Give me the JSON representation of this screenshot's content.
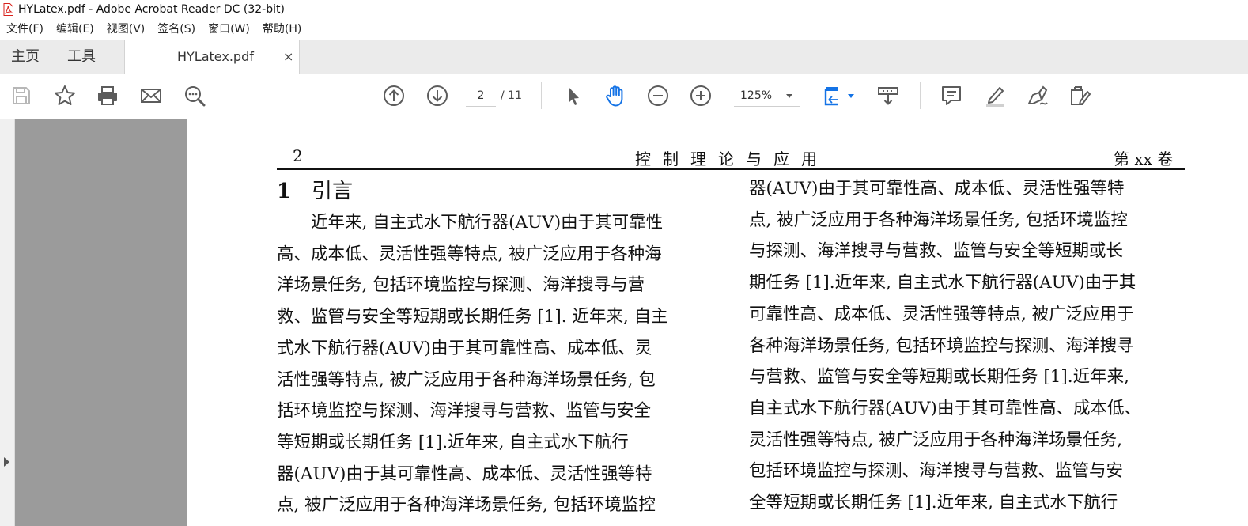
{
  "window": {
    "title": "HYLatex.pdf - Adobe Acrobat Reader DC (32-bit)"
  },
  "menu": [
    "文件(F)",
    "编辑(E)",
    "视图(V)",
    "签名(S)",
    "窗口(W)",
    "帮助(H)"
  ],
  "tabs": {
    "home": "主页",
    "tools": "工具",
    "document": "HYLatex.pdf",
    "close_glyph": "×"
  },
  "toolbar": {
    "icons": [
      "save-icon",
      "star-icon",
      "print-icon",
      "email-icon",
      "search-zoom-icon",
      "arrow-up-circle-icon",
      "arrow-down-circle-icon",
      "select-cursor-icon",
      "hand-tool-icon",
      "zoom-out-icon",
      "zoom-in-icon",
      "fit-page-icon",
      "scroll-mode-icon",
      "comment-icon",
      "highlight-icon",
      "sign-icon",
      "edit-pdf-icon"
    ],
    "page_current": "2",
    "page_total": "/ 11",
    "zoom": "125%"
  },
  "colors": {
    "accent_blue": "#1473e6",
    "icon_gray": "#5c5c5c",
    "sidebar_gray": "#9b9b9b",
    "pdf_red": "#d9221c"
  },
  "page": {
    "header_number": "2",
    "header_center": "控制理论与应用",
    "header_right": "第 xx 卷",
    "section_number": "1",
    "section_title": "引言",
    "left_column": [
      "　　近年来, 自主式水下航行器(AUV)由于其可靠性",
      "高、成本低、灵活性强等特点, 被广泛应用于各种海",
      "洋场景任务, 包括环境监控与探测、海洋搜寻与营",
      "救、监管与安全等短期或长期任务 [1]. 近年来, 自主",
      "式水下航行器(AUV)由于其可靠性高、成本低、灵",
      "活性强等特点, 被广泛应用于各种海洋场景任务, 包",
      "括环境监控与探测、海洋搜寻与营救、监管与安全",
      "等短期或长期任务 [1].近年来, 自主式水下航行",
      "器(AUV)由于其可靠性高、成本低、灵活性强等特",
      "点, 被广泛应用于各种海洋场景任务, 包括环境监控"
    ],
    "right_column": [
      "器(AUV)由于其可靠性高、成本低、灵活性强等特",
      "点, 被广泛应用于各种海洋场景任务, 包括环境监控",
      "与探测、海洋搜寻与营救、监管与安全等短期或长",
      "期任务 [1].近年来, 自主式水下航行器(AUV)由于其",
      "可靠性高、成本低、灵活性强等特点, 被广泛应用于",
      "各种海洋场景任务, 包括环境监控与探测、海洋搜寻",
      "与营救、监管与安全等短期或长期任务 [1].近年来,",
      "自主式水下航行器(AUV)由于其可靠性高、成本低、",
      "灵活性强等特点, 被广泛应用于各种海洋场景任务,",
      "包括环境监控与探测、海洋搜寻与营救、监管与安",
      "全等短期或长期任务 [1].近年来, 自主式水下航行"
    ]
  }
}
